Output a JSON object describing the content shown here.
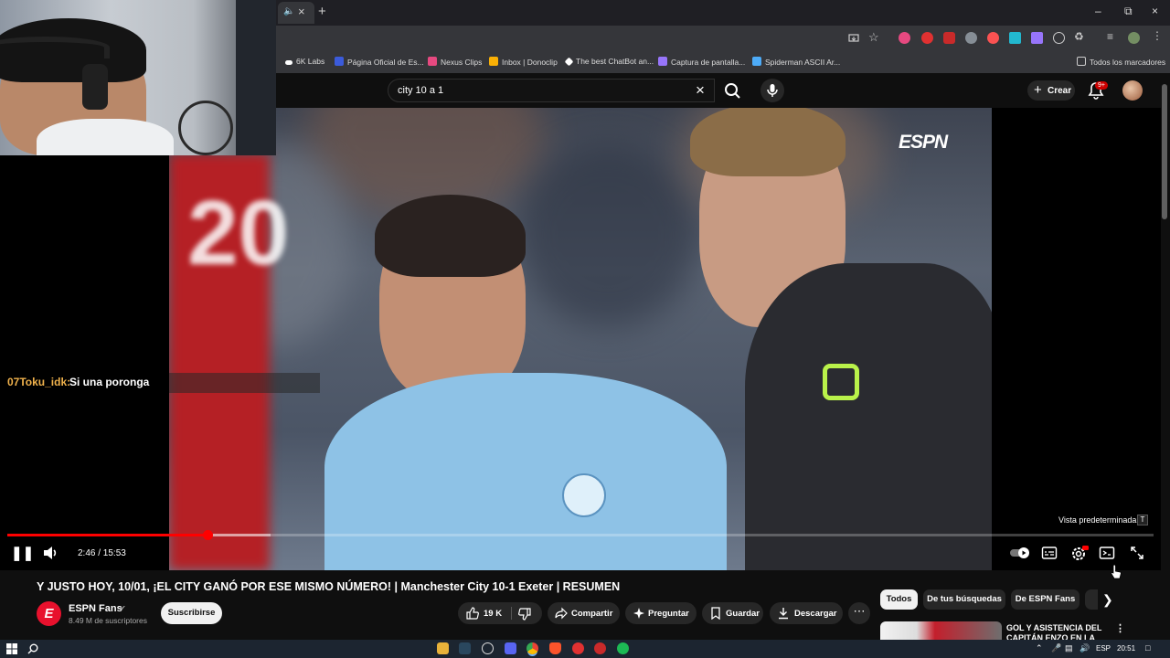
{
  "browser": {
    "tab_icon": "speaker-icon",
    "bookmarks": [
      {
        "label": "6K Labs",
        "color": "#ffffff"
      },
      {
        "label": "Página Oficial de Es...",
        "color": "#3b5bdb"
      },
      {
        "label": "Nexus Clips",
        "color": "#e64980"
      },
      {
        "label": "Inbox | Donoclip",
        "color": "#fab005"
      },
      {
        "label": "The best ChatBot an...",
        "color": "#ffffff"
      },
      {
        "label": "Captura de pantalla...",
        "color": "#9775fa"
      },
      {
        "label": "Spiderman ASCII Ar...",
        "color": "#4dabf7"
      }
    ],
    "all_bookmarks": "Todos los marcadores"
  },
  "youtube": {
    "search": {
      "value": "city 10 a 1"
    },
    "create_label": "Crear",
    "notif_count": "9+"
  },
  "player": {
    "brand": "ESPN",
    "current_time": "2:46",
    "duration": "15:53",
    "time_display": "2:46 / 15:53",
    "progress_fraction": 0.175,
    "buffer_fraction": 0.23,
    "default_view_label": "Vista predeterminada",
    "default_view_key": "T"
  },
  "chat": {
    "user": "07Toku_idk:",
    "message": "Si una poronga"
  },
  "video": {
    "title": "Y JUSTO HOY, 10/01, ¡EL CITY GANÓ POR ESE MISMO NÚMERO! | Manchester City 10-1 Exeter | RESUMEN",
    "channel_name": "ESPN Fans",
    "subscribers": "8.49 M de suscriptores",
    "subscribe_label": "Suscribirse",
    "likes": "19 K",
    "share_label": "Compartir",
    "ask_label": "Preguntar",
    "save_label": "Guardar",
    "download_label": "Descargar"
  },
  "chips": [
    "Todos",
    "De tus búsquedas",
    "De ESPN Fans"
  ],
  "recommendation": {
    "title": "GOL Y ASISTENCIA DEL CAPITÁN ENZO EN LA"
  },
  "taskbar": {
    "language": "ESP",
    "time": "20:51"
  },
  "colors": {
    "accent_red": "#ff0000",
    "youtube_bg": "#0f0f0f",
    "chat_user": "#f0b24c"
  }
}
